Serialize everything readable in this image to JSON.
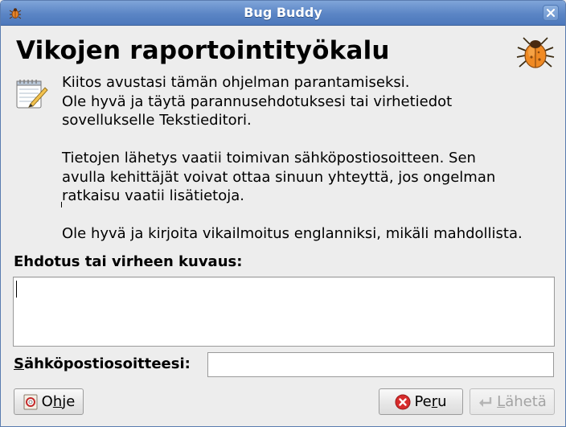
{
  "window": {
    "title": "Bug Buddy",
    "icon": "bug-icon",
    "close_icon": "close-icon"
  },
  "heading": "Vikojen raportointityökalu",
  "intro": {
    "line1": "Kiitos avustasi tämän ohjelman parantamiseksi.",
    "line2": "Ole hyvä ja täytä parannusehdotuksesi tai virhetiedot",
    "line3": "sovellukselle Tekstieditori.",
    "line4": "Tietojen lähetys vaatii toimivan sähköpostiosoitteen. Sen",
    "line5": "avulla kehittäjät voivat ottaa sinuun yhteyttä, jos ongelman",
    "line6": "ratkaisu vaatii lisätietoja.",
    "line7": "Ole hyvä ja kirjoita vikailmoitus englanniksi, mikäli mahdollista."
  },
  "description": {
    "label": "Ehdotus tai virheen kuvaus:",
    "value": ""
  },
  "email": {
    "label_mnemonic": "S",
    "label_rest": "ähköpostiosoitteesi:",
    "value": ""
  },
  "buttons": {
    "help_pre": "O",
    "help_mnemonic": "h",
    "help_post": "je",
    "cancel_pre": "Pe",
    "cancel_mnemonic": "r",
    "cancel_post": "u",
    "send_mnemonic": "L",
    "send_post": "ähetä"
  },
  "colors": {
    "titlebar": "#5b85c5",
    "window_bg": "#ededed",
    "cancel_icon": "#d72b2b",
    "disabled_text": "#a3a3a3"
  }
}
